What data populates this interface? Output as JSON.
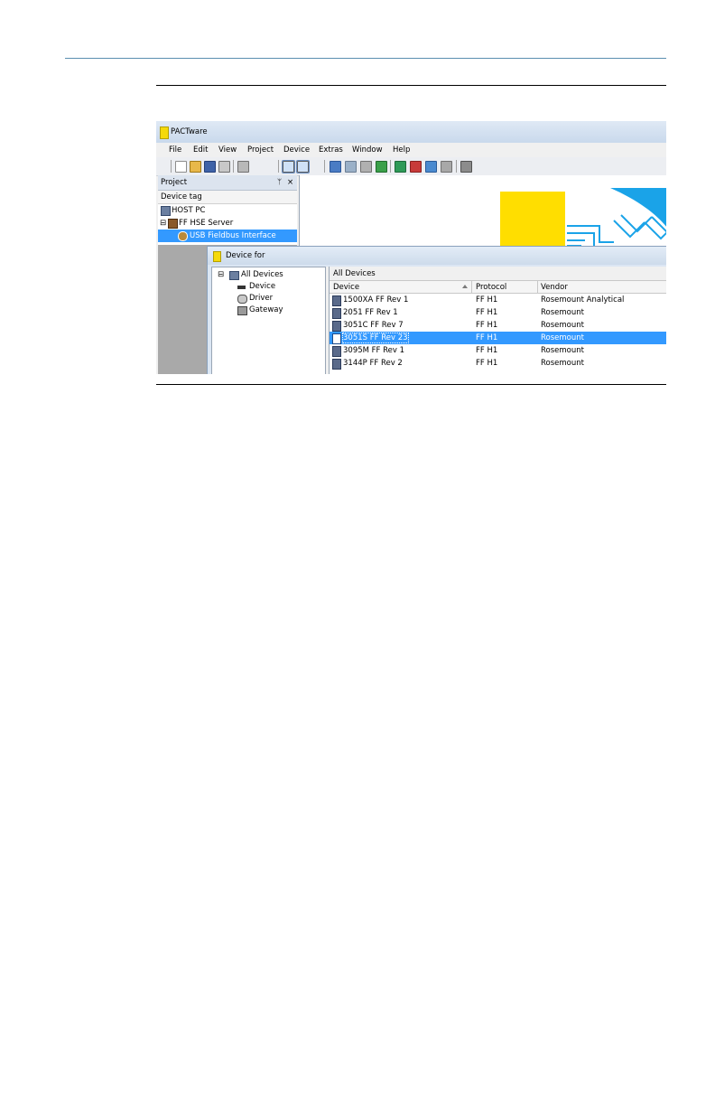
{
  "app": {
    "title": "PACTware"
  },
  "menu": [
    "File",
    "Edit",
    "View",
    "Project",
    "Device",
    "Extras",
    "Window",
    "Help"
  ],
  "toolbar": {
    "icons": [
      "new-icon",
      "open-icon",
      "save-icon",
      "print-icon",
      "print-preview-icon",
      "project-view-icon",
      "device-catalog-icon",
      "connect-icon",
      "disconnect-icon",
      "upload-icon",
      "download-icon",
      "parameter-icon",
      "online-icon",
      "offline-icon",
      "settings-icon"
    ]
  },
  "project_panel": {
    "title": "Project",
    "pin_glyph": "ᛘ",
    "close_glyph": "×",
    "column_header": "Device tag",
    "items": [
      {
        "label": "HOST PC",
        "icon": "computer-icon"
      },
      {
        "expander": "⊟",
        "label": "FF HSE Server",
        "icon": "server-icon"
      },
      {
        "label": "USB Fieldbus Interface",
        "icon": "usb-interface-icon",
        "selected": true
      }
    ]
  },
  "dialog": {
    "title": "Device for",
    "tree": [
      {
        "expander": "⊟",
        "label": "All Devices",
        "icon": "all-devices-icon"
      },
      {
        "label": "Device",
        "icon": "device-icon"
      },
      {
        "label": "Driver",
        "icon": "driver-icon"
      },
      {
        "label": "Gateway",
        "icon": "gateway-icon"
      }
    ],
    "panel_title": "All Devices",
    "columns": [
      "Device",
      "Protocol",
      "Vendor"
    ],
    "rows": [
      {
        "device": "1500XA FF Rev 1",
        "protocol": "FF H1",
        "vendor": "Rosemount Analytical"
      },
      {
        "device": "2051 FF Rev 1",
        "protocol": "FF H1",
        "vendor": "Rosemount"
      },
      {
        "device": "3051C FF Rev 7",
        "protocol": "FF H1",
        "vendor": "Rosemount"
      },
      {
        "device": "3051S FF Rev 23",
        "protocol": "FF H1",
        "vendor": "Rosemount",
        "selected": true
      },
      {
        "device": "3095M FF Rev 1",
        "protocol": "FF H1",
        "vendor": "Rosemount"
      },
      {
        "device": "3144P FF Rev 2",
        "protocol": "FF H1",
        "vendor": "Rosemount"
      }
    ]
  },
  "colors": {
    "selection": "#3399ff",
    "logo_yellow": "#ffde00",
    "logo_blue": "#1aa3e8",
    "header_rule": "#5a8fb0"
  }
}
